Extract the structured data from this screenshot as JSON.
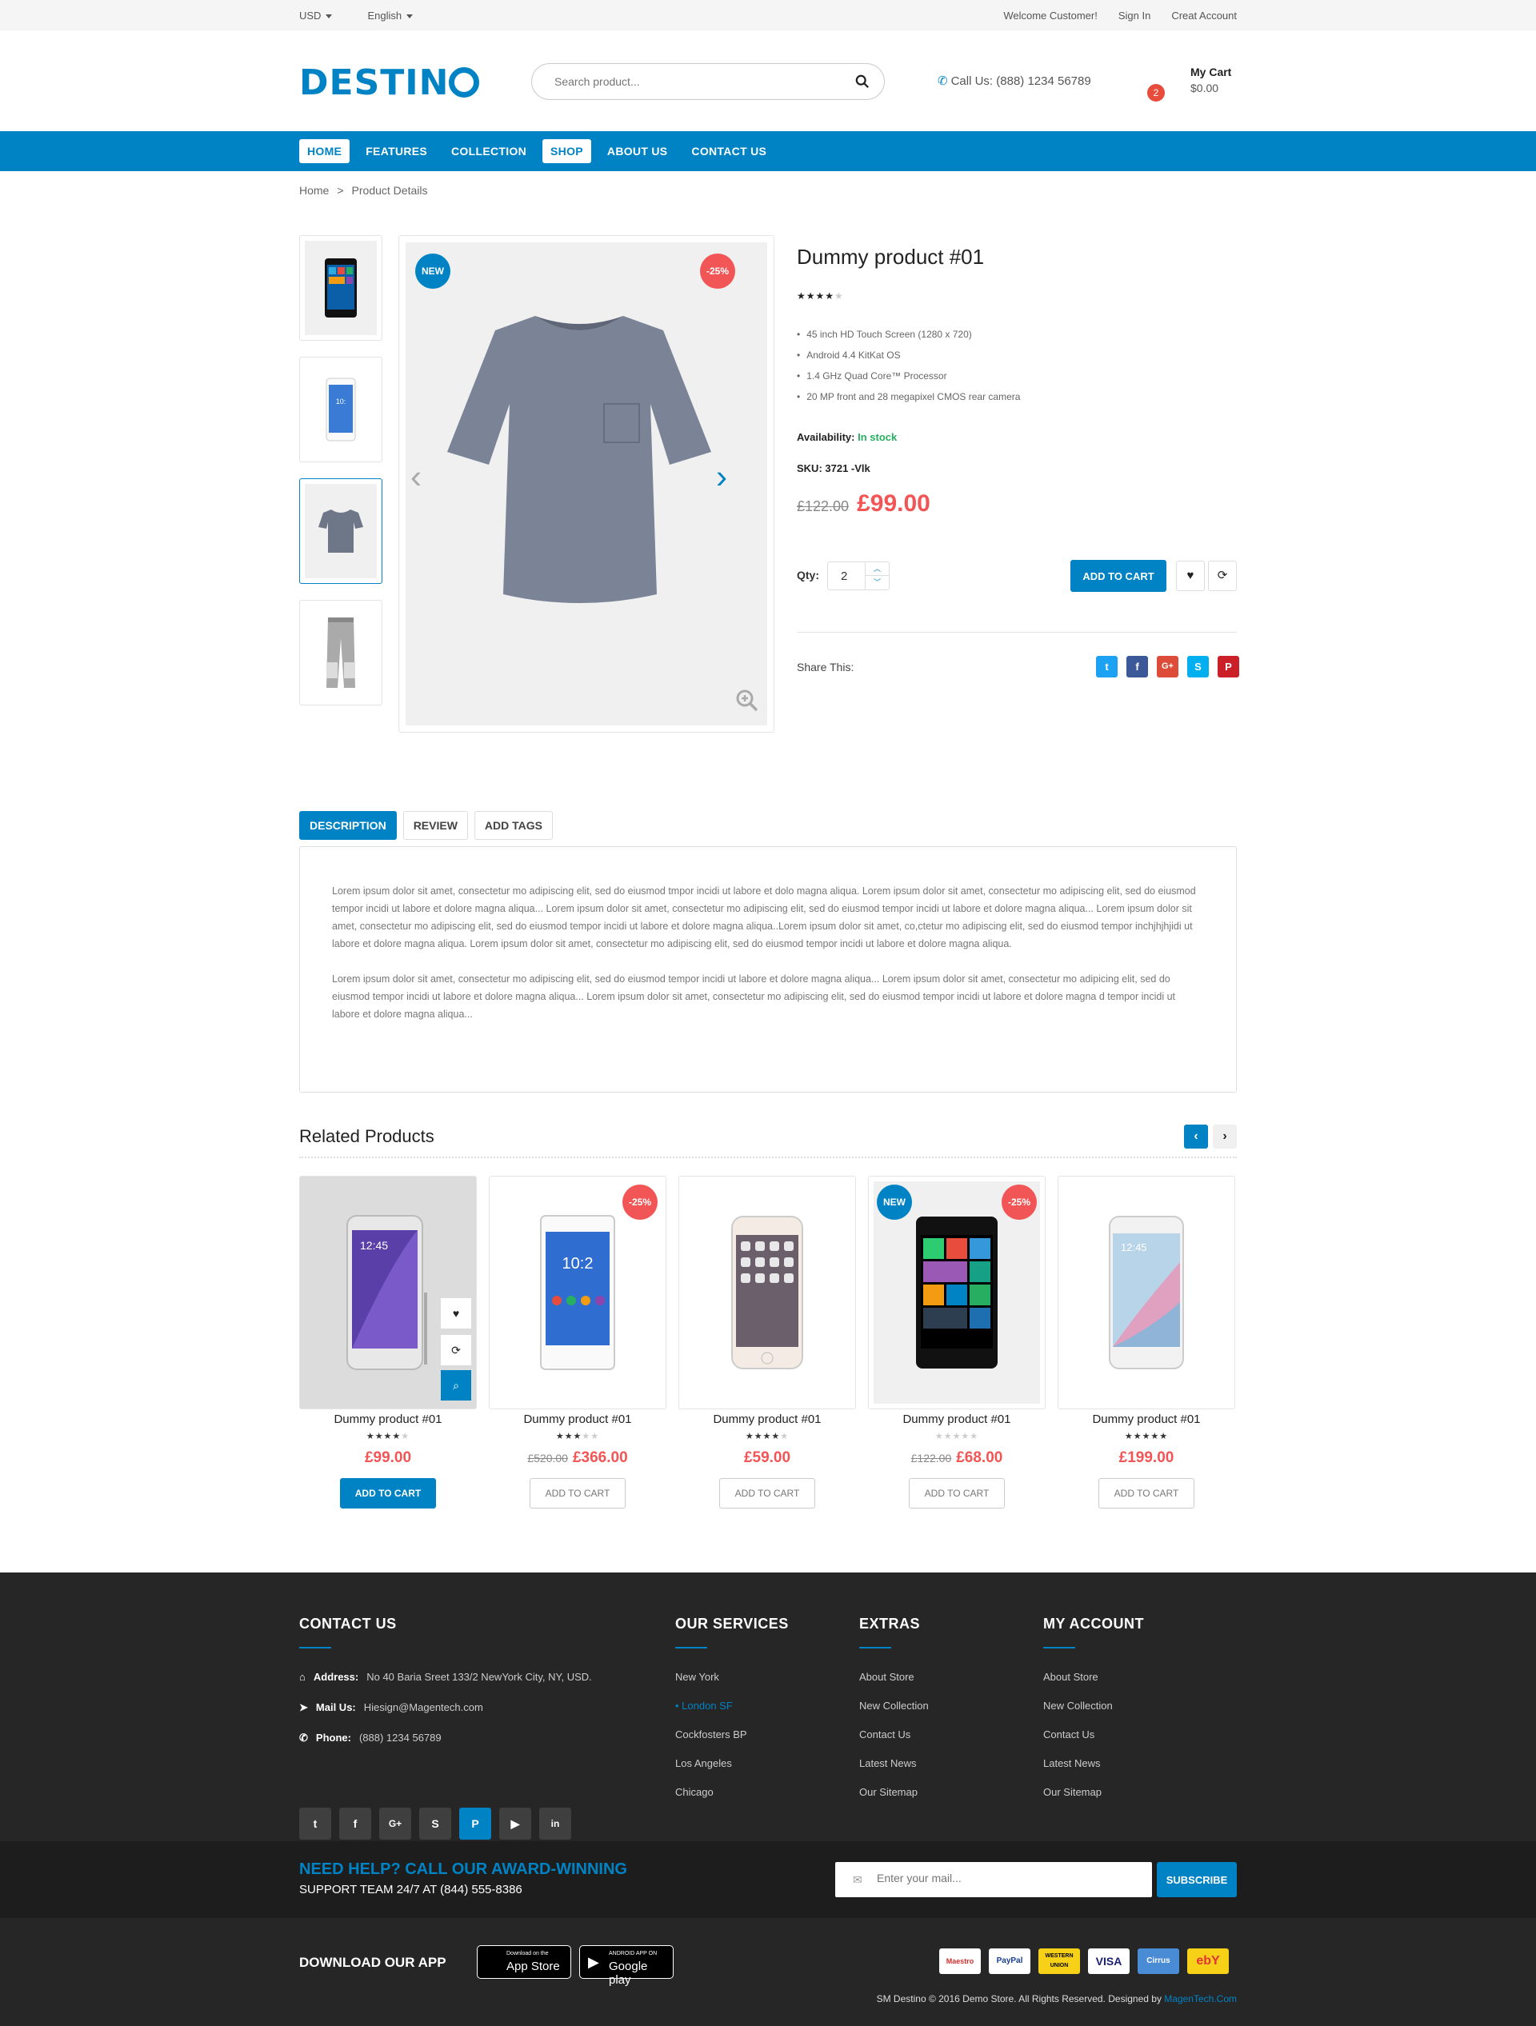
{
  "topbar": {
    "currency": "USD",
    "language": "English",
    "welcome": "Welcome Customer!",
    "signin": "Sign In",
    "create": "Creat Account"
  },
  "header": {
    "logo": "DESTINO",
    "search_placeholder": "Search product...",
    "call_label": "Call Us:",
    "phone": "(888) 1234 56789",
    "cart_title": "My Cart",
    "cart_count": "2",
    "cart_total": "$0.00"
  },
  "nav": [
    "HOME",
    "FEATURES",
    "COLLECTION",
    "SHOP",
    "ABOUT US",
    "CONTACT US"
  ],
  "breadcrumb": {
    "home": "Home",
    "sep": ">",
    "current": "Product Details"
  },
  "product": {
    "badge_new": "NEW",
    "badge_sale": "-25%",
    "title": "Dummy product #01",
    "rating": 4,
    "features": [
      "45 inch HD Touch Screen (1280 x 720)",
      "Android 4.4 KitKat OS",
      "1.4 GHz Quad Core™ Processor",
      "20 MP front and 28 megapixel CMOS rear camera"
    ],
    "avail_label": "Availability:",
    "avail_value": "In stock",
    "sku": "SKU: 3721 -Vlk",
    "old_price": "£122.00",
    "price": "£99.00",
    "qty_label": "Qty:",
    "qty": "2",
    "add_to_cart": "ADD TO CART",
    "share_label": "Share This:"
  },
  "tabs": [
    "DESCRIPTION",
    "REVIEW",
    "ADD TAGS"
  ],
  "description": [
    "Lorem ipsum dolor sit amet, consectetur mo adipiscing elit, sed do eiusmod tmpor incidi ut labore et dolo magna aliqua. Lorem ipsum dolor sit amet, consectetur mo adipiscing elit, sed do eiusmod tempor incidi ut labore et dolore magna aliqua... Lorem ipsum dolor sit amet, consectetur mo adipiscing elit, sed do eiusmod tempor incidi ut labore et dolore magna aliqua... Lorem ipsum dolor sit amet, consectetur mo adipiscing elit, sed do eiusmod tempor incidi ut labore et dolore magna aliqua..Lorem ipsum dolor sit amet, co,ctetur mo adipiscing elit, sed do eiusmod tempor inchjhjhjidi ut labore et dolore magna aliqua. Lorem ipsum dolor sit amet, consectetur mo adipiscing elit, sed do eiusmod tempor incidi ut labore et dolore magna aliqua.",
    "Lorem ipsum dolor sit amet, consectetur mo adipiscing elit, sed do eiusmod tempor incidi ut labore et dolore magna aliqua... Lorem ipsum dolor sit amet, consectetur mo adipicing elit, sed do eiusmod tempor incidi ut labore et dolore magna aliqua... Lorem ipsum dolor sit amet, consectetur mo adipiscing elit, sed do eiusmod tempor incidi ut labore et dolore magna d tempor incidi ut labore et dolore magna aliqua..."
  ],
  "related": {
    "title": "Related Products",
    "items": [
      {
        "name": "Dummy product #01",
        "rating": 4,
        "old": "",
        "price": "£99.00",
        "btn": "ADD TO CART",
        "badge_new": "",
        "badge_sale": ""
      },
      {
        "name": "Dummy product #01",
        "rating": 3,
        "old": "£520.00",
        "price": "£366.00",
        "btn": "ADD TO CART",
        "badge_new": "",
        "badge_sale": "-25%"
      },
      {
        "name": "Dummy product #01",
        "rating": 4,
        "old": "",
        "price": "£59.00",
        "btn": "ADD TO CART",
        "badge_new": "",
        "badge_sale": ""
      },
      {
        "name": "Dummy product #01",
        "rating": 0,
        "old": "£122.00",
        "price": "£68.00",
        "btn": "ADD TO CART",
        "badge_new": "NEW",
        "badge_sale": "-25%"
      },
      {
        "name": "Dummy product #01",
        "rating": 5,
        "old": "",
        "price": "£199.00",
        "btn": "ADD TO CART",
        "badge_new": "",
        "badge_sale": ""
      }
    ]
  },
  "footer": {
    "contact": {
      "title": "CONTACT US",
      "address_label": "Address:",
      "address": "No 40 Baria Sreet 133/2 NewYork City, NY, USD.",
      "mail_label": "Mail Us:",
      "mail": "Hiesign@Magentech.com",
      "phone_label": "Phone:",
      "phone": "(888) 1234 56789"
    },
    "services": {
      "title": "OUR SERVICES",
      "items": [
        "New York",
        "London SF",
        "Cockfosters BP",
        "Los Angeles",
        "Chicago"
      ]
    },
    "extras": {
      "title": "EXTRAS",
      "items": [
        "About Store",
        "New Collection",
        "Contact Us",
        "Latest News",
        "Our Sitemap"
      ]
    },
    "account": {
      "title": "MY ACCOUNT",
      "items": [
        "About Store",
        "New Collection",
        "Contact Us",
        "Latest News",
        "Our Sitemap"
      ]
    }
  },
  "help": {
    "line1": "NEED HELP? CALL OUR AWARD-WINNING",
    "line2": "SUPPORT TEAM 24/7 AT (844) 555-8386",
    "mail_placeholder": "Enter your mail...",
    "subscribe": "SUBSCRIBE"
  },
  "bottom": {
    "download": "DOWNLOAD OUR APP",
    "appstore_small": "Download on the",
    "appstore": "App Store",
    "gplay_small": "ANDROID APP ON",
    "gplay": "Google play",
    "copyright": "SM Destino © 2016 Demo Store. All Rights Reserved. Designed by",
    "designer": "MagenTech.Com",
    "payments": [
      "Maestro",
      "PayPal",
      "WESTERN UNION",
      "VISA",
      "Cirrus",
      "ebY"
    ]
  },
  "colors": {
    "primary": "#0083c4",
    "sale": "#f25555",
    "stock": "#27ae60",
    "footer_bg": "#262626"
  }
}
